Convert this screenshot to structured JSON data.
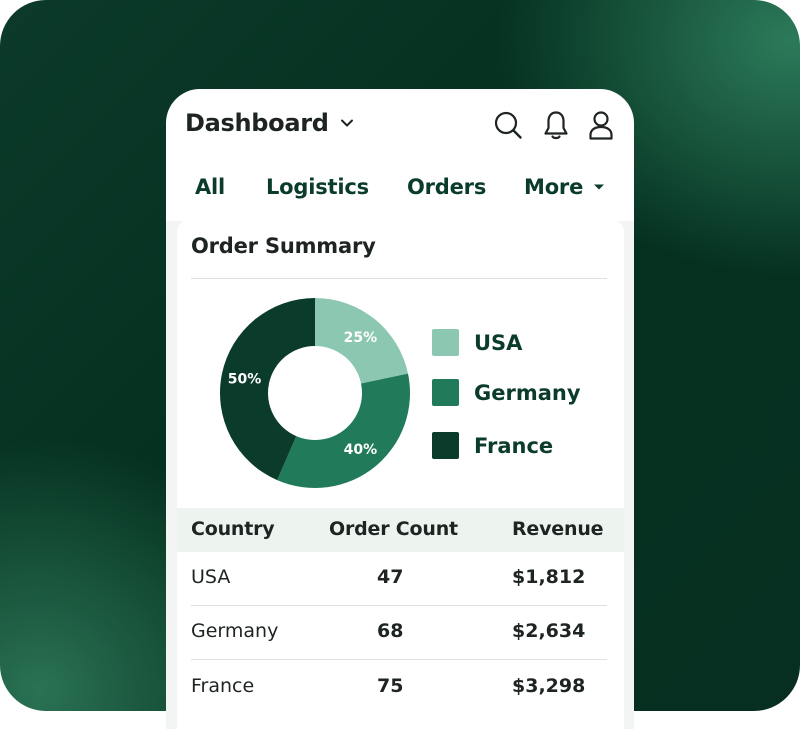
{
  "header": {
    "title": "Dashboard",
    "icons": [
      "chevron-down-icon",
      "search-icon",
      "bell-icon",
      "user-icon"
    ]
  },
  "tabs": [
    {
      "label": "All"
    },
    {
      "label": "Logistics"
    },
    {
      "label": "Orders"
    },
    {
      "label": "More"
    }
  ],
  "card": {
    "title": "Order Summary"
  },
  "chart_data": {
    "type": "pie",
    "title": "",
    "donut": true,
    "legend_position": "right",
    "categories": [
      "USA",
      "Germany",
      "France"
    ],
    "values": [
      25,
      40,
      50
    ],
    "labels": [
      "25%",
      "40%",
      "50%"
    ],
    "colors": [
      "#8cc8b1",
      "#217a5a",
      "#0b3b2a"
    ]
  },
  "table": {
    "columns": [
      "Country",
      "Order Count",
      "Revenue"
    ],
    "rows": [
      {
        "country": "USA",
        "orders": "47",
        "revenue": "$1,812"
      },
      {
        "country": "Germany",
        "orders": "68",
        "revenue": "$2,634"
      },
      {
        "country": "France",
        "orders": "75",
        "revenue": "$3,298"
      }
    ]
  },
  "colors": {
    "brand_dark": "#0b3b2a",
    "brand_mid": "#217a5a",
    "brand_light": "#8cc8b1",
    "table_header_bg": "#edf4f0"
  }
}
